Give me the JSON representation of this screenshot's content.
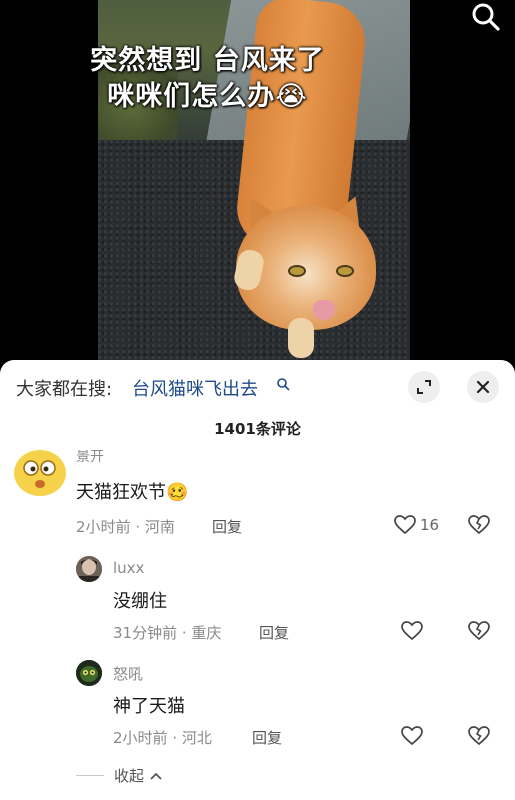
{
  "video": {
    "overlay_line1": "突然想到 台风来了",
    "overlay_line2": "咪咪们怎么办😭"
  },
  "header": {
    "trend_prefix": "大家都在搜:",
    "trend_query": "台风猫咪飞出去"
  },
  "comments_title": "1401条评论",
  "comments": [
    {
      "username": "景开",
      "text": "天猫狂欢节🥴",
      "time": "2小时前",
      "location": "河南",
      "reply_label": "回复",
      "likes": "16"
    }
  ],
  "replies": [
    {
      "username": "luxx",
      "text": "没绷住",
      "time": "31分钟前",
      "location": "重庆",
      "reply_label": "回复"
    },
    {
      "username": "怒吼",
      "text": "神了天猫",
      "time": "2小时前",
      "location": "河北",
      "reply_label": "回复"
    }
  ],
  "collapse_label": "收起",
  "colors": {
    "trend_query": "#1f4b8a",
    "meta_gray": "#8a8a8a",
    "sheet_bg": "#ffffff"
  },
  "icons": [
    "search-icon",
    "trend-search-icon",
    "expand-icon",
    "close-icon",
    "heart-icon",
    "broken-heart-icon",
    "chevron-up-icon"
  ]
}
